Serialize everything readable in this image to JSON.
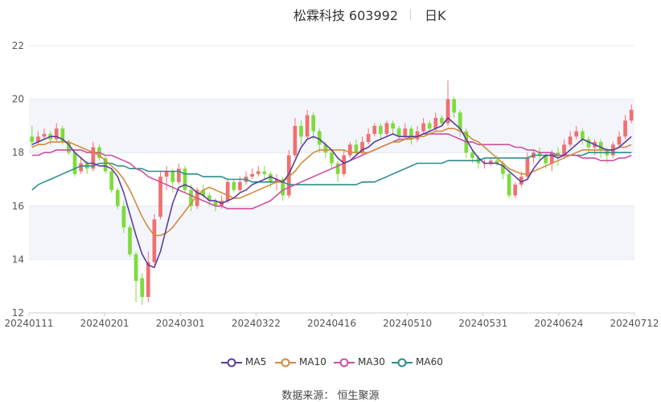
{
  "title": {
    "stock": "松霖科技 603992",
    "period": "日K"
  },
  "source_text": "数据来源： 恒生聚源",
  "colors": {
    "up": "#f07070",
    "down": "#7ddc3c",
    "ma5": "#5b3d9b",
    "ma10": "#d48a3c",
    "ma30": "#cc4f9f",
    "ma60": "#2b8c8c",
    "grid": "#e4e8f0",
    "band": "#f3f5fb"
  },
  "chart_data": {
    "type": "candlestick",
    "title": "松霖科技 603992",
    "subtitle": "日K",
    "ylim": [
      12,
      22
    ],
    "yticks": [
      12,
      14,
      16,
      18,
      20,
      22
    ],
    "xticks": [
      "20240111",
      "20240201",
      "20240301",
      "20240322",
      "20240416",
      "20240510",
      "20240531",
      "20240624",
      "20240712"
    ],
    "legend": [
      "MA5",
      "MA10",
      "MA30",
      "MA60"
    ],
    "legend_position": "bottom",
    "grid": true,
    "candles": [
      [
        18.6,
        18.4,
        19.0,
        18.2
      ],
      [
        18.4,
        18.6,
        18.8,
        18.3
      ],
      [
        18.6,
        18.7,
        18.9,
        18.5
      ],
      [
        18.7,
        18.5,
        18.8,
        18.3
      ],
      [
        18.5,
        18.9,
        19.1,
        18.4
      ],
      [
        18.9,
        18.4,
        19.0,
        18.3
      ],
      [
        18.4,
        18.0,
        18.5,
        17.9
      ],
      [
        18.0,
        17.2,
        18.1,
        17.1
      ],
      [
        17.3,
        17.6,
        17.8,
        17.2
      ],
      [
        17.6,
        17.4,
        17.7,
        17.2
      ],
      [
        17.4,
        18.2,
        18.4,
        17.3
      ],
      [
        18.2,
        17.8,
        18.3,
        17.7
      ],
      [
        17.8,
        17.3,
        17.9,
        17.2
      ],
      [
        17.3,
        16.6,
        17.4,
        16.5
      ],
      [
        16.6,
        16.0,
        16.7,
        15.9
      ],
      [
        16.0,
        15.2,
        16.2,
        15.0
      ],
      [
        15.2,
        14.2,
        15.3,
        14.1
      ],
      [
        14.2,
        13.2,
        14.3,
        12.4
      ],
      [
        13.3,
        12.6,
        13.5,
        12.3
      ],
      [
        12.6,
        13.9,
        14.3,
        12.4
      ],
      [
        13.9,
        15.5,
        15.7,
        13.8
      ],
      [
        15.6,
        17.1,
        17.3,
        15.5
      ],
      [
        17.1,
        17.3,
        17.5,
        16.6
      ],
      [
        17.3,
        16.9,
        17.4,
        16.5
      ],
      [
        16.9,
        17.4,
        17.6,
        16.8
      ],
      [
        17.4,
        16.6,
        17.5,
        16.5
      ],
      [
        16.6,
        16.0,
        16.8,
        15.8
      ],
      [
        16.0,
        16.6,
        16.7,
        15.9
      ],
      [
        16.6,
        16.4,
        16.8,
        16.3
      ],
      [
        16.4,
        16.2,
        16.5,
        16.0
      ],
      [
        16.2,
        16.0,
        16.3,
        15.8
      ],
      [
        16.0,
        16.2,
        16.4,
        15.9
      ],
      [
        16.2,
        16.9,
        17.0,
        16.1
      ],
      [
        16.9,
        16.6,
        17.0,
        16.5
      ],
      [
        16.6,
        16.9,
        17.1,
        16.5
      ],
      [
        16.9,
        17.1,
        17.3,
        16.8
      ],
      [
        17.1,
        17.2,
        17.4,
        17.0
      ],
      [
        17.2,
        17.3,
        17.5,
        17.1
      ],
      [
        17.3,
        17.2,
        17.5,
        17.0
      ],
      [
        17.2,
        16.9,
        17.3,
        16.7
      ],
      [
        16.9,
        17.0,
        17.2,
        16.6
      ],
      [
        17.0,
        16.4,
        17.1,
        16.2
      ],
      [
        16.4,
        17.9,
        18.1,
        16.3
      ],
      [
        17.9,
        19.0,
        19.3,
        17.8
      ],
      [
        19.0,
        18.6,
        19.2,
        18.3
      ],
      [
        18.6,
        19.4,
        19.6,
        18.5
      ],
      [
        19.4,
        18.8,
        19.5,
        18.5
      ],
      [
        18.8,
        18.3,
        18.9,
        18.0
      ],
      [
        18.3,
        18.0,
        18.4,
        17.8
      ],
      [
        18.0,
        17.6,
        18.1,
        17.4
      ],
      [
        17.6,
        17.2,
        17.7,
        16.9
      ],
      [
        17.2,
        17.9,
        18.1,
        17.1
      ],
      [
        17.9,
        18.3,
        18.4,
        17.8
      ],
      [
        18.3,
        18.0,
        18.5,
        17.9
      ],
      [
        18.0,
        18.4,
        18.6,
        17.9
      ],
      [
        18.4,
        18.7,
        18.9,
        18.3
      ],
      [
        18.7,
        19.0,
        19.1,
        18.6
      ],
      [
        19.0,
        18.7,
        19.1,
        18.5
      ],
      [
        18.7,
        19.1,
        19.2,
        18.6
      ],
      [
        19.1,
        18.9,
        19.2,
        18.7
      ],
      [
        18.9,
        18.6,
        19.0,
        18.4
      ],
      [
        18.6,
        18.9,
        19.1,
        18.5
      ],
      [
        18.9,
        18.5,
        19.0,
        18.3
      ],
      [
        18.5,
        18.8,
        19.0,
        18.4
      ],
      [
        18.8,
        19.1,
        19.3,
        18.7
      ],
      [
        19.1,
        18.9,
        19.2,
        18.7
      ],
      [
        18.9,
        19.3,
        19.5,
        18.8
      ],
      [
        19.3,
        19.1,
        19.4,
        19.0
      ],
      [
        19.1,
        20.0,
        20.7,
        19.0
      ],
      [
        20.0,
        19.5,
        20.1,
        19.3
      ],
      [
        19.5,
        18.8,
        19.6,
        18.6
      ],
      [
        18.8,
        18.0,
        18.9,
        17.8
      ],
      [
        18.0,
        17.8,
        18.1,
        17.6
      ],
      [
        17.8,
        17.6,
        17.9,
        17.4
      ],
      [
        17.6,
        17.6,
        17.8,
        17.4
      ],
      [
        17.6,
        17.7,
        17.8,
        17.5
      ],
      [
        17.7,
        17.6,
        17.9,
        17.5
      ],
      [
        17.6,
        17.2,
        17.7,
        17.0
      ],
      [
        17.2,
        16.4,
        17.3,
        16.3
      ],
      [
        16.4,
        16.8,
        16.9,
        16.3
      ],
      [
        16.8,
        17.1,
        17.3,
        16.7
      ],
      [
        17.1,
        17.8,
        18.0,
        17.0
      ],
      [
        17.8,
        18.0,
        18.1,
        17.6
      ],
      [
        18.0,
        17.9,
        18.2,
        17.7
      ],
      [
        17.9,
        17.6,
        18.0,
        17.4
      ],
      [
        17.6,
        18.0,
        18.1,
        17.3
      ],
      [
        18.0,
        17.9,
        18.2,
        17.5
      ],
      [
        17.9,
        18.3,
        18.5,
        17.8
      ],
      [
        18.3,
        18.6,
        18.8,
        18.2
      ],
      [
        18.6,
        18.8,
        19.0,
        18.5
      ],
      [
        18.8,
        18.5,
        18.9,
        18.3
      ],
      [
        18.5,
        18.2,
        18.6,
        18.0
      ],
      [
        18.2,
        18.4,
        18.5,
        17.9
      ],
      [
        18.4,
        18.1,
        18.5,
        17.8
      ],
      [
        18.1,
        17.9,
        18.2,
        17.6
      ],
      [
        17.9,
        18.3,
        18.4,
        17.8
      ],
      [
        18.3,
        18.6,
        18.8,
        18.2
      ],
      [
        18.6,
        19.2,
        19.4,
        18.5
      ],
      [
        19.2,
        19.6,
        19.8,
        19.1
      ]
    ],
    "ma5": [
      18.3,
      18.4,
      18.5,
      18.6,
      18.6,
      18.5,
      18.3,
      18.0,
      17.8,
      17.6,
      17.6,
      17.5,
      17.5,
      17.4,
      17.1,
      16.5,
      15.7,
      14.9,
      14.2,
      13.8,
      13.7,
      14.3,
      15.2,
      16.1,
      16.7,
      16.8,
      16.7,
      16.5,
      16.4,
      16.2,
      16.2,
      16.1,
      16.2,
      16.3,
      16.5,
      16.6,
      16.8,
      16.9,
      17.0,
      17.1,
      17.0,
      16.9,
      17.2,
      17.7,
      18.2,
      18.5,
      18.6,
      18.5,
      18.3,
      18.1,
      17.8,
      17.6,
      17.7,
      17.9,
      18.1,
      18.2,
      18.4,
      18.5,
      18.6,
      18.7,
      18.6,
      18.6,
      18.6,
      18.6,
      18.7,
      18.8,
      18.9,
      19.0,
      19.3,
      19.1,
      18.9,
      18.5,
      18.1,
      17.8,
      17.6,
      17.6,
      17.6,
      17.5,
      17.3,
      17.1,
      16.9,
      17.0,
      17.4,
      17.7,
      17.9,
      17.9,
      17.8,
      17.9,
      18.1,
      18.3,
      18.5,
      18.4,
      18.3,
      18.2,
      18.1,
      18.1,
      18.2,
      18.4,
      18.6
    ],
    "ma10": [
      18.2,
      18.3,
      18.3,
      18.4,
      18.4,
      18.4,
      18.4,
      18.3,
      18.2,
      18.1,
      18.0,
      17.9,
      17.7,
      17.5,
      17.3,
      17.0,
      16.6,
      16.1,
      15.6,
      15.2,
      14.9,
      14.9,
      15.0,
      15.2,
      15.5,
      15.8,
      16.1,
      16.4,
      16.6,
      16.7,
      16.6,
      16.5,
      16.4,
      16.3,
      16.3,
      16.4,
      16.5,
      16.6,
      16.7,
      16.8,
      16.9,
      16.9,
      17.1,
      17.3,
      17.6,
      17.8,
      18.0,
      18.1,
      18.1,
      18.1,
      18.1,
      18.1,
      18.0,
      18.0,
      18.0,
      18.0,
      18.1,
      18.2,
      18.3,
      18.4,
      18.4,
      18.5,
      18.5,
      18.6,
      18.6,
      18.7,
      18.8,
      18.8,
      18.9,
      18.9,
      18.8,
      18.7,
      18.5,
      18.4,
      18.2,
      18.0,
      17.8,
      17.6,
      17.4,
      17.3,
      17.2,
      17.2,
      17.3,
      17.4,
      17.5,
      17.6,
      17.7,
      17.8,
      17.9,
      18.0,
      18.1,
      18.1,
      18.1,
      18.1,
      18.1,
      18.1,
      18.2,
      18.2,
      18.3
    ],
    "ma30": [
      17.9,
      17.9,
      18.0,
      18.0,
      18.1,
      18.1,
      18.1,
      18.1,
      18.1,
      18.0,
      18.0,
      18.0,
      17.9,
      17.9,
      17.8,
      17.7,
      17.6,
      17.4,
      17.3,
      17.1,
      17.0,
      16.9,
      16.8,
      16.7,
      16.6,
      16.5,
      16.4,
      16.3,
      16.2,
      16.1,
      16.0,
      16.0,
      15.9,
      15.9,
      15.9,
      15.9,
      15.9,
      16.0,
      16.1,
      16.2,
      16.4,
      16.6,
      16.7,
      16.8,
      16.9,
      17.0,
      17.1,
      17.2,
      17.3,
      17.4,
      17.5,
      17.6,
      17.7,
      17.8,
      17.9,
      18.0,
      18.1,
      18.2,
      18.3,
      18.4,
      18.5,
      18.5,
      18.6,
      18.6,
      18.7,
      18.7,
      18.7,
      18.7,
      18.7,
      18.6,
      18.5,
      18.4,
      18.4,
      18.3,
      18.3,
      18.3,
      18.3,
      18.3,
      18.3,
      18.2,
      18.2,
      18.1,
      18.1,
      18.0,
      18.0,
      18.0,
      17.9,
      17.9,
      17.9,
      17.9,
      17.8,
      17.8,
      17.8,
      17.7,
      17.7,
      17.7,
      17.8,
      17.8,
      17.9
    ],
    "ma60": [
      16.6,
      16.8,
      16.9,
      17.0,
      17.1,
      17.2,
      17.3,
      17.4,
      17.5,
      17.5,
      17.5,
      17.6,
      17.6,
      17.6,
      17.5,
      17.5,
      17.4,
      17.4,
      17.4,
      17.3,
      17.3,
      17.3,
      17.3,
      17.3,
      17.3,
      17.2,
      17.2,
      17.2,
      17.1,
      17.1,
      17.1,
      17.1,
      17.0,
      17.0,
      17.0,
      17.0,
      16.9,
      16.9,
      16.9,
      16.9,
      16.9,
      16.9,
      16.8,
      16.8,
      16.8,
      16.8,
      16.8,
      16.8,
      16.8,
      16.8,
      16.8,
      16.8,
      16.8,
      16.8,
      16.9,
      16.9,
      16.9,
      17.0,
      17.1,
      17.2,
      17.3,
      17.4,
      17.5,
      17.6,
      17.6,
      17.6,
      17.6,
      17.6,
      17.7,
      17.7,
      17.7,
      17.7,
      17.7,
      17.7,
      17.8,
      17.8,
      17.8,
      17.8,
      17.8,
      17.8,
      17.8,
      17.8,
      17.9,
      17.9,
      17.9,
      17.9,
      17.9,
      17.9,
      17.9,
      17.9,
      17.9,
      18.0,
      18.0,
      18.0,
      18.0,
      18.0,
      18.0,
      18.0,
      18.0
    ]
  }
}
